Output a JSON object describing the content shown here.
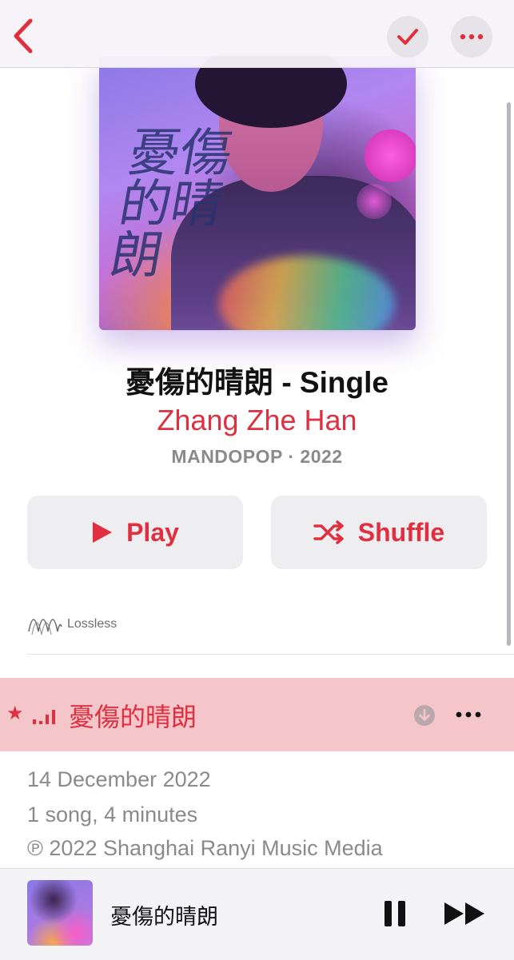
{
  "album": {
    "title": "憂傷的晴朗 - Single",
    "artist": "Zhang Zhe Han",
    "meta": "MANDOPOP · 2022",
    "art_text": "憂傷的晴朗"
  },
  "buttons": {
    "play": "Play",
    "shuffle": "Shuffle"
  },
  "badge": {
    "lossless": "Lossless"
  },
  "tracks": [
    {
      "title": "憂傷的晴朗",
      "favorite": true,
      "playing": true
    }
  ],
  "info": {
    "release_date": "14 December 2022",
    "count": "1 song, 4 minutes",
    "copyright": "℗ 2022 Shanghai Ranyi Music Media"
  },
  "now_playing": {
    "title": "憂傷的晴朗"
  },
  "colors": {
    "accent": "#e0303f",
    "secondary_text": "#8a8a8e",
    "highlight_row": "#f4c5c9"
  },
  "icons": {
    "back": "chevron-left-icon",
    "check": "checkmark-icon",
    "more": "ellipsis-icon",
    "play": "play-icon",
    "shuffle": "shuffle-icon",
    "lossless": "lossless-waveform-icon",
    "favorite": "star-icon",
    "now_playing": "equalizer-icon",
    "download": "download-icon",
    "pause": "pause-icon",
    "next": "forward-icon"
  }
}
